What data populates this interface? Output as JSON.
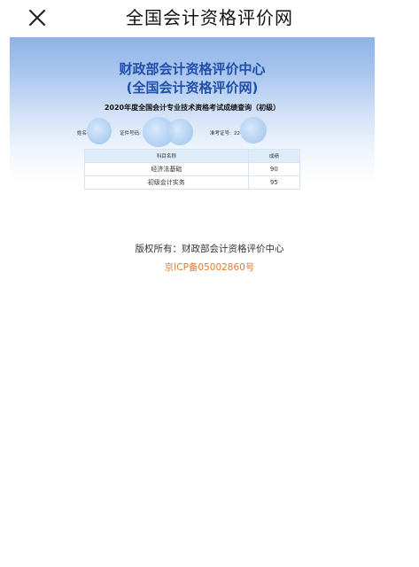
{
  "header": {
    "title": "全国会计资格评价网",
    "close_icon": "close-icon"
  },
  "banner": {
    "center_name": "财政部会计资格评价中心",
    "center_sub": "(全国会计资格评价网)",
    "query_title": "2020年度全国会计专业技术资格考试成绩查询（初级）",
    "name_label": "姓名:",
    "id_label": "证件号码:",
    "exam_no_label": "准考证号:",
    "exam_no_prefix": "22",
    "colors": {
      "title_blue": "#1f4fa8",
      "gradient_top": "#8fb2e6"
    }
  },
  "scores": {
    "headers": [
      "科目名称",
      "成绩"
    ],
    "rows": [
      [
        "经济法基础",
        "90"
      ],
      [
        "初级会计实务",
        "95"
      ]
    ]
  },
  "footer": {
    "copyright": "版权所有：财政部会计资格评价中心",
    "icp": "京ICP备05002860号",
    "icp_color": "#e07a2c"
  }
}
